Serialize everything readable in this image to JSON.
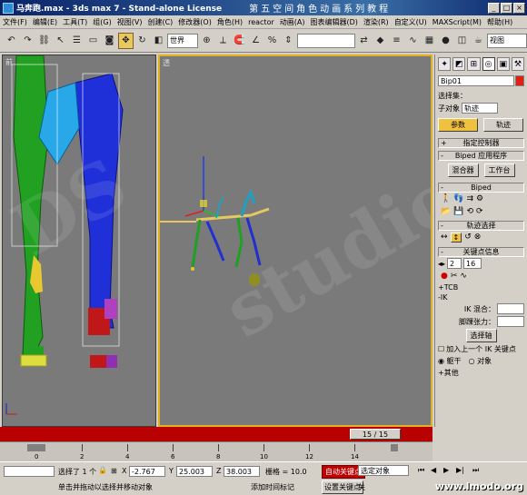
{
  "titlebar": {
    "file_title": "马奔跑.max - 3ds max 7 - Stand-alone License",
    "tutorial_title": "第五空间角色动画系列教程"
  },
  "menu": [
    "文件(F)",
    "编辑(E)",
    "工具(T)",
    "组(G)",
    "视图(V)",
    "创建(C)",
    "修改器(O)",
    "角色(H)",
    "reactor",
    "动画(A)",
    "图表编辑器(D)",
    "渲染(R)",
    "自定义(U)",
    "MAXScript(M)",
    "帮助(H)"
  ],
  "toolbar": {
    "coord_system": "世界",
    "view_dropdown": "视图"
  },
  "viewports": {
    "left_label": "前",
    "right_label": "透"
  },
  "panel": {
    "object_name": "Bip01",
    "selection_set_label": "选择集：",
    "subobject_label": "子对象",
    "subobject_value": "轨迹",
    "tab_params": "参数",
    "tab_tracks": "轨迹",
    "rollouts": {
      "assign_controller": "指定控制器",
      "biped_apps": "Biped 应用程序",
      "biped": "Biped",
      "track_selection": "轨迹选择",
      "key_info": "关键点信息"
    },
    "mixer_button": "混合器",
    "workbench_button": "工作台",
    "key_number": "2",
    "key_time": "16",
    "tcb_label": "+TCB",
    "ik_label": "-IK",
    "ik_blend_label": "IK 混合：",
    "ankle_label": "脚踝张力：",
    "select_pivot_button": "选择轴",
    "join_prev_ik": "加入上一个 IK 关键点",
    "body_radio": "躯干",
    "object_radio": "对象",
    "extras_label": "+其他"
  },
  "timeline": {
    "frame_counter": "15 / 15",
    "ticks": [
      "0",
      "2",
      "4",
      "6",
      "8",
      "10",
      "12",
      "14"
    ]
  },
  "statusbar": {
    "selected_label": "选择了 1 个",
    "x_value": "-2.767",
    "y_value": "25.003",
    "z_value": "38.003",
    "grid_label": "栅格 = 10.0",
    "prompt": "单击并拖动以选择并移动对象",
    "add_time_tag": "添加时间标记",
    "auto_key": "自动关键点",
    "set_key": "设置关键点",
    "key_filter": "选定对象",
    "key_filters_btn": "关",
    "watermark": "www.lmodo.org"
  }
}
